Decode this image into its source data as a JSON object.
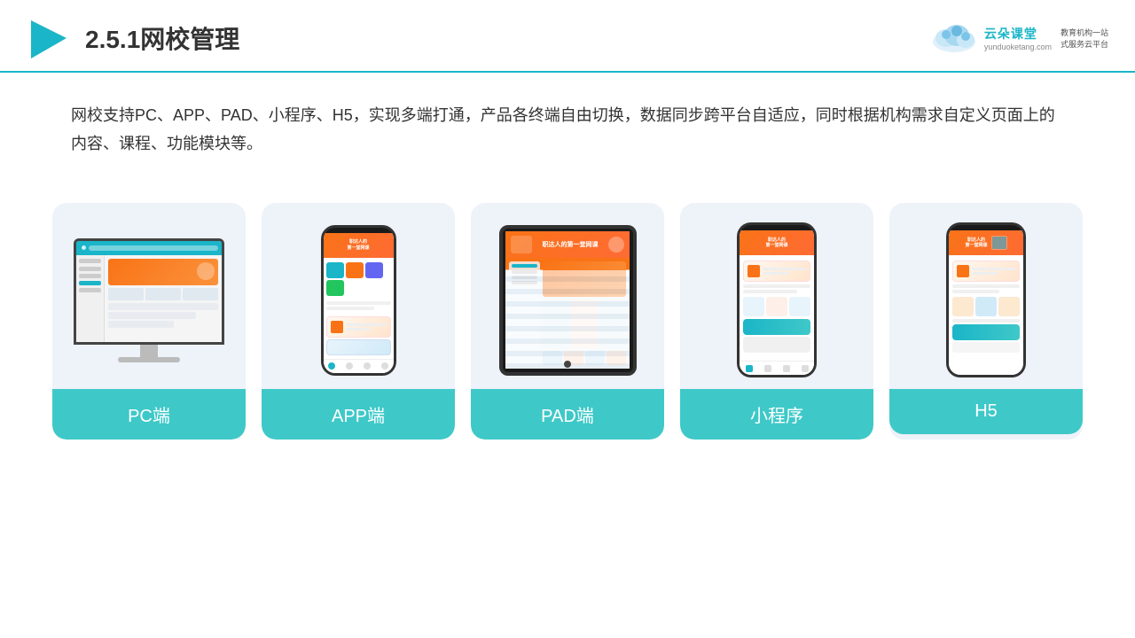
{
  "header": {
    "title": "2.5.1网校管理",
    "logo_brand": "云朵课堂",
    "logo_domain": "yunduoketang.com",
    "logo_tagline": "教育机构一站",
    "logo_tagline2": "式服务云平台"
  },
  "description": {
    "text": "网校支持PC、APP、PAD、小程序、H5，实现多端打通，产品各终端自由切换，数据同步跨平台自适应，同时根据机构需求自定义页面上的内容、课程、功能模块等。"
  },
  "cards": [
    {
      "id": "pc",
      "label": "PC端"
    },
    {
      "id": "app",
      "label": "APP端"
    },
    {
      "id": "pad",
      "label": "PAD端"
    },
    {
      "id": "mini",
      "label": "小程序"
    },
    {
      "id": "h5",
      "label": "H5"
    }
  ],
  "colors": {
    "teal": "#3fc8c8",
    "orange": "#f97316",
    "bg_card": "#eef2f8",
    "header_line": "#1ab5c8"
  }
}
